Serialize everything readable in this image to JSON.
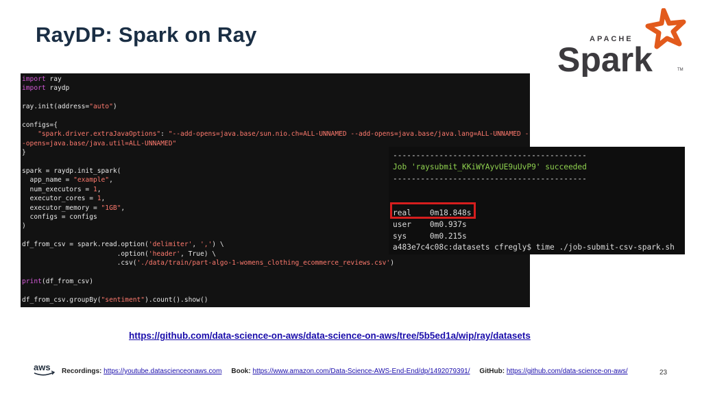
{
  "slide": {
    "title": "RayDP:  Spark on Ray",
    "page_number": "23"
  },
  "logo": {
    "top_text": "APACHE",
    "main_text": "Spark",
    "tm": "TM"
  },
  "code_lines": [
    [
      "kw:import",
      " ray"
    ],
    [
      "kw:import",
      " raydp"
    ],
    [
      ""
    ],
    [
      "ray.init(address=",
      "st:\"auto\"",
      ")"
    ],
    [
      ""
    ],
    [
      "configs={"
    ],
    [
      "    ",
      "st:\"spark.driver.extraJavaOptions\"",
      ": ",
      "st:\"--add-opens=java.base/sun.nio.ch=ALL-UNNAMED --add-opens=java.base/java.lang=ALL-UNNAMED --add"
    ],
    [
      "st:-opens=java.base/java.util=ALL-UNNAMED\""
    ],
    [
      "}"
    ],
    [
      ""
    ],
    [
      "spark = raydp.init_spark("
    ],
    [
      "  app_name = ",
      "st:\"example\"",
      ","
    ],
    [
      "  num_executors = ",
      "nm:1",
      ","
    ],
    [
      "  executor_cores = ",
      "nm:1",
      ","
    ],
    [
      "  executor_memory = ",
      "st:\"1GB\"",
      ","
    ],
    [
      "  configs = configs"
    ],
    [
      ")"
    ],
    [
      ""
    ],
    [
      "df_from_csv = spark.read.option(",
      "st:'delimiter'",
      ", ",
      "st:','",
      ") \\"
    ],
    [
      "                        .option(",
      "st:'header'",
      ", True) \\"
    ],
    [
      "                        .csv(",
      "st:'./data/train/part-algo-1-womens_clothing_ecommerce_reviews.csv'",
      ")"
    ],
    [
      ""
    ],
    [
      "kw:print",
      "(df_from_csv)"
    ],
    [
      ""
    ],
    [
      "df_from_csv.groupBy(",
      "st:\"sentiment\"",
      ").count().show()"
    ]
  ],
  "terminal_lines": [
    [
      "------------------------------------------"
    ],
    [
      "ok:Job 'raysubmit_KKiWYAyvUE9uUvP9' succeeded"
    ],
    [
      "------------------------------------------"
    ],
    [
      ""
    ],
    [
      ""
    ],
    [
      "real    0m18.848s"
    ],
    [
      "user    0m0.937s"
    ],
    [
      "sys     0m0.215s"
    ],
    [
      "a483e7c4c08c:datasets cfregly$ time ./job-submit-csv-spark.sh"
    ]
  ],
  "link": {
    "url": "https://github.com/data-science-on-aws/data-science-on-aws/tree/5b5ed1a/wip/ray/datasets"
  },
  "footer": {
    "recordings_label": "Recordings:",
    "recordings_url": "https://youtube.datascienceonaws.com",
    "book_label": "Book:",
    "book_url": "https://www.amazon.com/Data-Science-AWS-End-End/dp/1492079391/",
    "github_label": "GitHub:",
    "github_url": "https://github.com/data-science-on-aws/"
  },
  "aws_logo_text": "aws",
  "colors": {
    "title": "#1a2e44",
    "spark_orange": "#e25a1c",
    "spark_gray": "#3c3a3e",
    "highlight_box": "#d61e1e"
  }
}
